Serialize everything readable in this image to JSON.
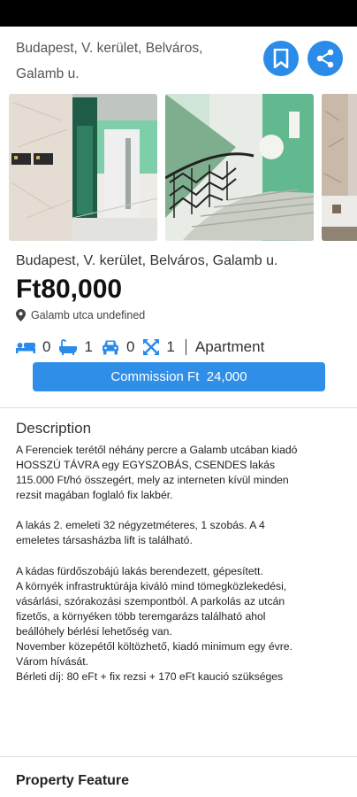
{
  "header": {
    "address_line": "Budapest, V. kerület, Belváros, Galamb u.",
    "bookmark_icon": "bookmark-icon",
    "share_icon": "share-icon",
    "accent_color": "#2a8ce8"
  },
  "gallery": {
    "photos": [
      "photo-hallway-entrance",
      "photo-stairwell",
      "photo-interior-partial"
    ]
  },
  "listing": {
    "title": "Budapest, V. kerület, Belváros, Galamb u.",
    "price": "Ft80,000",
    "location": "Galamb utca undefined",
    "location_icon": "map-pin-icon",
    "features": {
      "bedrooms": "0",
      "bathrooms": "1",
      "parking": "0",
      "area": "1",
      "property_type": "Apartment"
    },
    "commission_label": "Commission Ft  24,000"
  },
  "description": {
    "heading": "Description",
    "paragraphs": [
      "A Ferenciek terétől néhány percre a Galamb utcában kiadó HOSSZÚ TÁVRA egy EGYSZOBÁS, CSENDES lakás 115.000 Ft/hó összegért, mely az interneten kívül minden rezsit magában foglaló fix lakbér.",
      "A lakás 2. emeleti 32 négyzetméteres, 1 szobás. A 4 emeletes társasházba lift is található.",
      "A kádas fürdőszobájú lakás berendezett, gépesített.",
      "A környék infrastruktúrája kiváló mind tömegközlekedési, vásárlási, szórakozási szempontból. A parkolás az utcán fizetős, a környéken több teremgarázs található ahol beállóhely bérlési lehetőség van.",
      "November közepétől költözhető, kiadó minimum egy évre.",
      "Várom hívását.",
      "Bérleti díj: 80 eFt + fix rezsi + 170 eFt kaució szükséges"
    ]
  },
  "property_feature": {
    "heading": "Property Feature"
  }
}
